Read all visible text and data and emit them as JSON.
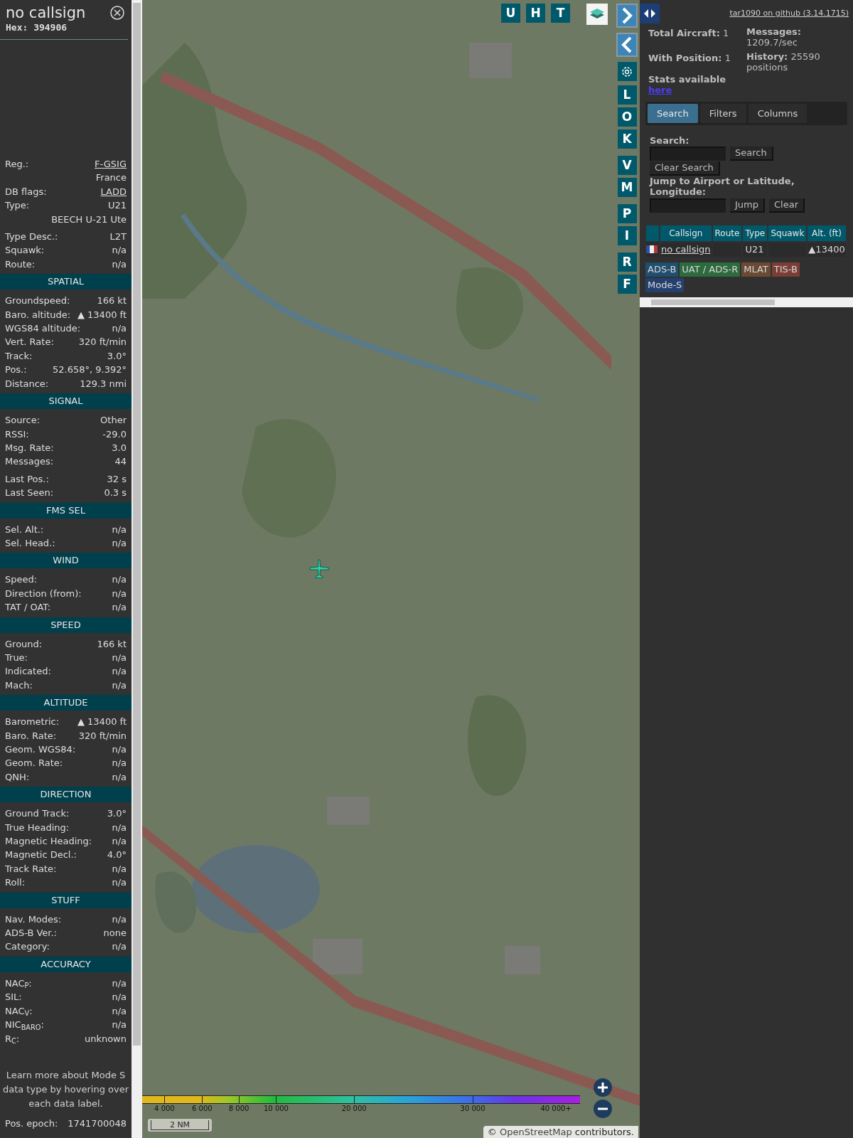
{
  "details": {
    "callsign": "no callsign",
    "hex": "Hex: 394906",
    "info_groups": [
      [
        {
          "label": "Reg.:",
          "value": "F-GSIG",
          "kind": "link"
        },
        {
          "value": "France",
          "kind": "plain"
        },
        {
          "label": "DB flags:",
          "value": "LADD",
          "kind": "link"
        },
        {
          "label": "Type:",
          "value": "U21",
          "kind": "plain"
        },
        {
          "value": "BEECH U-21 Ute",
          "kind": "plain"
        }
      ],
      [
        {
          "label": "Type Desc.:",
          "value": "L2T",
          "kind": "plain"
        },
        {
          "label": "Squawk:",
          "value": "n/a",
          "kind": "plain"
        },
        {
          "label": "Route:",
          "value": "n/a",
          "kind": "plain"
        }
      ]
    ],
    "sections": [
      {
        "title": "SPATIAL",
        "groups": [
          [
            {
              "label": "Groundspeed:",
              "value": "166 kt"
            },
            {
              "label": "Baro. altitude:",
              "value": "▲ 13400 ft"
            },
            {
              "label": "WGS84 altitude:",
              "value": "n/a"
            },
            {
              "label": "Vert. Rate:",
              "value": "320 ft/min"
            },
            {
              "label": "Track:",
              "value": "3.0°"
            },
            {
              "label": "Pos.:",
              "value": "52.658°, 9.392°"
            },
            {
              "label": "Distance:",
              "value": "129.3 nmi"
            }
          ]
        ]
      },
      {
        "title": "SIGNAL",
        "groups": [
          [
            {
              "label": "Source:",
              "value": "Other"
            },
            {
              "label": "RSSI:",
              "value": "-29.0"
            },
            {
              "label": "Msg. Rate:",
              "value": "3.0"
            },
            {
              "label": "Messages:",
              "value": "44"
            }
          ],
          [
            {
              "label": "Last Pos.:",
              "value": "32 s"
            },
            {
              "label": "Last Seen:",
              "value": "0.3 s"
            }
          ]
        ]
      },
      {
        "title": "FMS SEL",
        "groups": [
          [
            {
              "label": "Sel. Alt.:",
              "value": "n/a"
            },
            {
              "label": "Sel. Head.:",
              "value": "n/a"
            }
          ]
        ]
      },
      {
        "title": "WIND",
        "groups": [
          [
            {
              "label": "Speed:",
              "value": "n/a"
            },
            {
              "label": "Direction (from):",
              "value": "n/a"
            },
            {
              "label": "TAT / OAT:",
              "value": "n/a"
            }
          ]
        ]
      },
      {
        "title": "SPEED",
        "groups": [
          [
            {
              "label": "Ground:",
              "value": "166 kt"
            },
            {
              "label": "True:",
              "value": "n/a"
            },
            {
              "label": "Indicated:",
              "value": "n/a"
            },
            {
              "label": "Mach:",
              "value": "n/a"
            }
          ]
        ]
      },
      {
        "title": "ALTITUDE",
        "groups": [
          [
            {
              "label": "Barometric:",
              "value": "▲ 13400 ft"
            },
            {
              "label": "Baro. Rate:",
              "value": "320 ft/min"
            },
            {
              "label": "Geom. WGS84:",
              "value": "n/a"
            },
            {
              "label": "Geom. Rate:",
              "value": "n/a"
            },
            {
              "label": "QNH:",
              "value": "n/a"
            }
          ]
        ]
      },
      {
        "title": "DIRECTION",
        "groups": [
          [
            {
              "label": "Ground Track:",
              "value": "3.0°"
            },
            {
              "label": "True Heading:",
              "value": "n/a"
            },
            {
              "label": "Magnetic Heading:",
              "value": "n/a"
            },
            {
              "label": "Magnetic Decl.:",
              "value": "4.0°"
            },
            {
              "label": "Track Rate:",
              "value": "n/a"
            },
            {
              "label": "Roll:",
              "value": "n/a"
            }
          ]
        ]
      },
      {
        "title": "STUFF",
        "groups": [
          [
            {
              "label": "Nav. Modes:",
              "value": "n/a"
            },
            {
              "label": "ADS-B Ver.:",
              "value": "none"
            },
            {
              "label": "Category:",
              "value": "n/a"
            }
          ]
        ]
      },
      {
        "title": "ACCURACY",
        "groups": [
          [
            {
              "label": "NAC$_{P}$:",
              "value": "n/a"
            },
            {
              "label": "SIL:",
              "value": "n/a"
            },
            {
              "label": "NAC$_{V}$:",
              "value": "n/a"
            },
            {
              "label": "NIC$_{BARO}$:",
              "value": "n/a"
            },
            {
              "label": "R$_{C}$:",
              "value": "unknown"
            }
          ]
        ]
      }
    ],
    "footer": "Learn more about Mode S data type by hovering over each data label.",
    "epoch": {
      "label": "Pos. epoch:",
      "value": "1741700048"
    }
  },
  "map": {
    "top_buttons": [
      "U",
      "H",
      "T"
    ],
    "side_button_groups": [
      [
        "L",
        "O",
        "K"
      ],
      [
        "V",
        "M"
      ],
      [
        "P",
        "I"
      ],
      [
        "R",
        "F"
      ]
    ],
    "altitude_legend": [
      "4 000",
      "6 000",
      "8 000",
      "10 000",
      "20 000",
      "30 000",
      "40 000+"
    ],
    "scale": "2 NM",
    "attribution": {
      "prefix": "©",
      "link": "OpenStreetMap",
      "suffix": "contributors."
    }
  },
  "panel": {
    "github_link": "tar1090 on github (3.14.1715)",
    "stats_left": [
      "**Total Aircraft:** 1",
      "**With Position:** 1"
    ],
    "stats_right": [
      "**Messages:** 1209.7/sec",
      "**History:** 25590 positions"
    ],
    "stats_note": "Stats available",
    "stats_link": "here",
    "tabs": [
      {
        "label": "Search",
        "selected": true
      },
      {
        "label": "Filters",
        "selected": false
      },
      {
        "label": "Columns",
        "selected": false
      }
    ],
    "search": {
      "label": "Search:",
      "button": "Search",
      "clear_button": "Clear Search"
    },
    "jump": {
      "label": "Jump to Airport or Latitude, Longitude:",
      "button": "Jump",
      "clear_button": "Clear"
    },
    "table": {
      "columns": [
        "Callsign",
        "Route",
        "Type",
        "Squawk",
        "Alt. (ft)"
      ],
      "rows": [
        {
          "callsign": "no callsign",
          "type": "U21",
          "altitude": "▲13400"
        }
      ]
    },
    "legend": [
      {
        "label": "ADS-B",
        "color": "#1f4e6e"
      },
      {
        "label": "UAT / ADS-R",
        "color": "#2d6a3e"
      },
      {
        "label": "MLAT",
        "color": "#6b4a34"
      },
      {
        "label": "TIS-B",
        "color": "#7a3e36"
      },
      {
        "label": "Mode-S",
        "color": "#24406e"
      }
    ]
  }
}
